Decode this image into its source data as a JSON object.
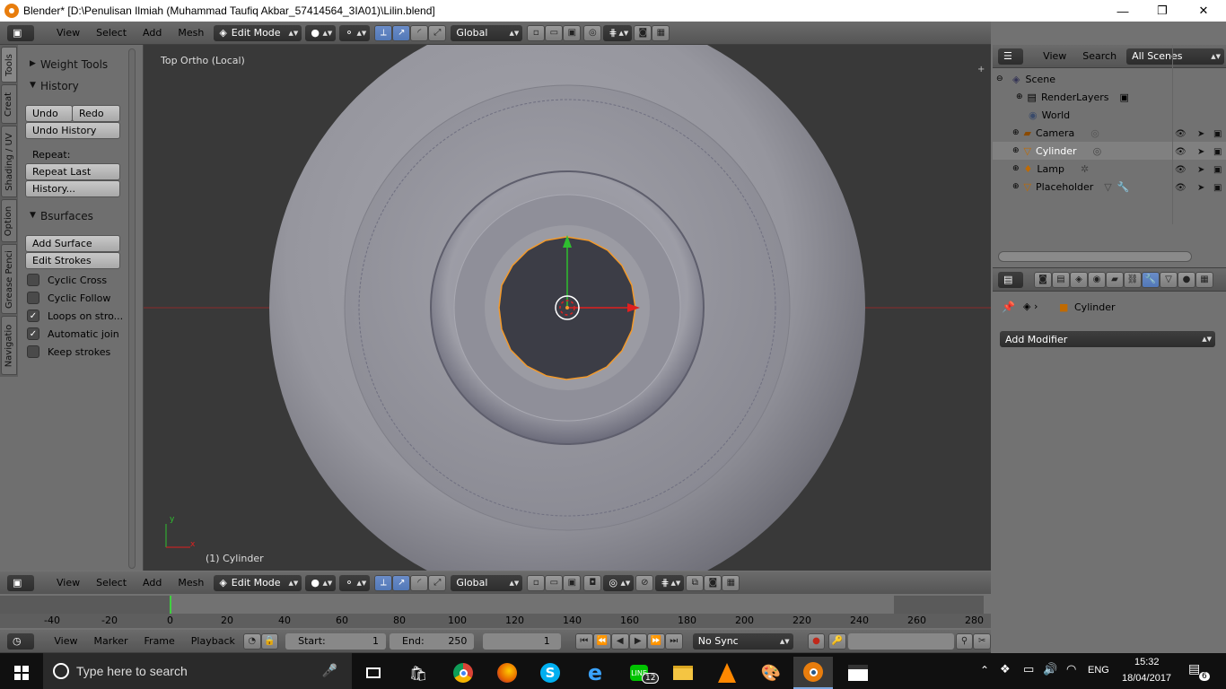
{
  "window": {
    "title": "Blender* [D:\\Penulisan Ilmiah (Muhammad Taufiq Akbar_57414564_3IA01)\\Lilin.blend]",
    "minimize": "—",
    "restore": "❐",
    "close": "✕"
  },
  "top_header": {
    "menus": [
      "View",
      "Select",
      "Mesh"
    ],
    "mode": "Edit Mode",
    "orientation": "Global"
  },
  "tool_tabs": [
    "Tools",
    "Creat",
    "Shading / UV",
    "Option",
    "Grease Penci",
    "Navigatio"
  ],
  "tool_panels": {
    "weight_tools": "Weight Tools",
    "history": "History",
    "undo": "Undo",
    "redo": "Redo",
    "undo_history": "Undo History",
    "repeat_label": "Repeat:",
    "repeat_last": "Repeat Last",
    "history_btn": "History...",
    "bsurfaces": "Bsurfaces",
    "add_surface": "Add Surface",
    "edit_strokes": "Edit Strokes",
    "options": [
      {
        "label": "Cyclic Cross",
        "checked": false
      },
      {
        "label": "Cyclic Follow",
        "checked": false
      },
      {
        "label": "Loops on stro...",
        "checked": true
      },
      {
        "label": "Automatic join",
        "checked": true
      },
      {
        "label": "Keep strokes",
        "checked": false
      }
    ]
  },
  "viewport": {
    "view_name": "Top Ortho (Local)",
    "object_label": "(1) Cylinder",
    "axis_x": "x",
    "axis_y": "y"
  },
  "outliner": {
    "menus": [
      "View",
      "Search"
    ],
    "scene_filter": "All Scenes",
    "items": [
      {
        "label": "Scene"
      },
      {
        "label": "RenderLayers"
      },
      {
        "label": "World"
      },
      {
        "label": "Camera"
      },
      {
        "label": "Cylinder"
      },
      {
        "label": "Lamp"
      },
      {
        "label": "Placeholder"
      }
    ]
  },
  "properties": {
    "object_name": "Cylinder",
    "add_modifier": "Add Modifier"
  },
  "bottom_header": {
    "menus": [
      "View",
      "Select",
      "Add",
      "Mesh"
    ],
    "mode": "Edit Mode",
    "orientation": "Global"
  },
  "timeline": {
    "ticks": [
      "-40",
      "-20",
      "0",
      "20",
      "40",
      "60",
      "80",
      "100",
      "120",
      "140",
      "160",
      "180",
      "200",
      "220",
      "240",
      "260",
      "280"
    ],
    "menus": [
      "View",
      "Marker",
      "Frame",
      "Playback"
    ],
    "start_label": "Start:",
    "start_value": "1",
    "end_label": "End:",
    "end_value": "250",
    "current_frame": "1",
    "sync": "No Sync"
  },
  "taskbar": {
    "search_placeholder": "Type here to search",
    "line_badge": "12",
    "lang": "ENG",
    "time": "15:32",
    "date": "18/04/2017",
    "notif_count": "6"
  },
  "colors": {
    "accent_orange": "#f39a2b",
    "x_axis": "#e0201f",
    "y_axis": "#2fbf2f",
    "selection_blue": "#5278b8"
  }
}
